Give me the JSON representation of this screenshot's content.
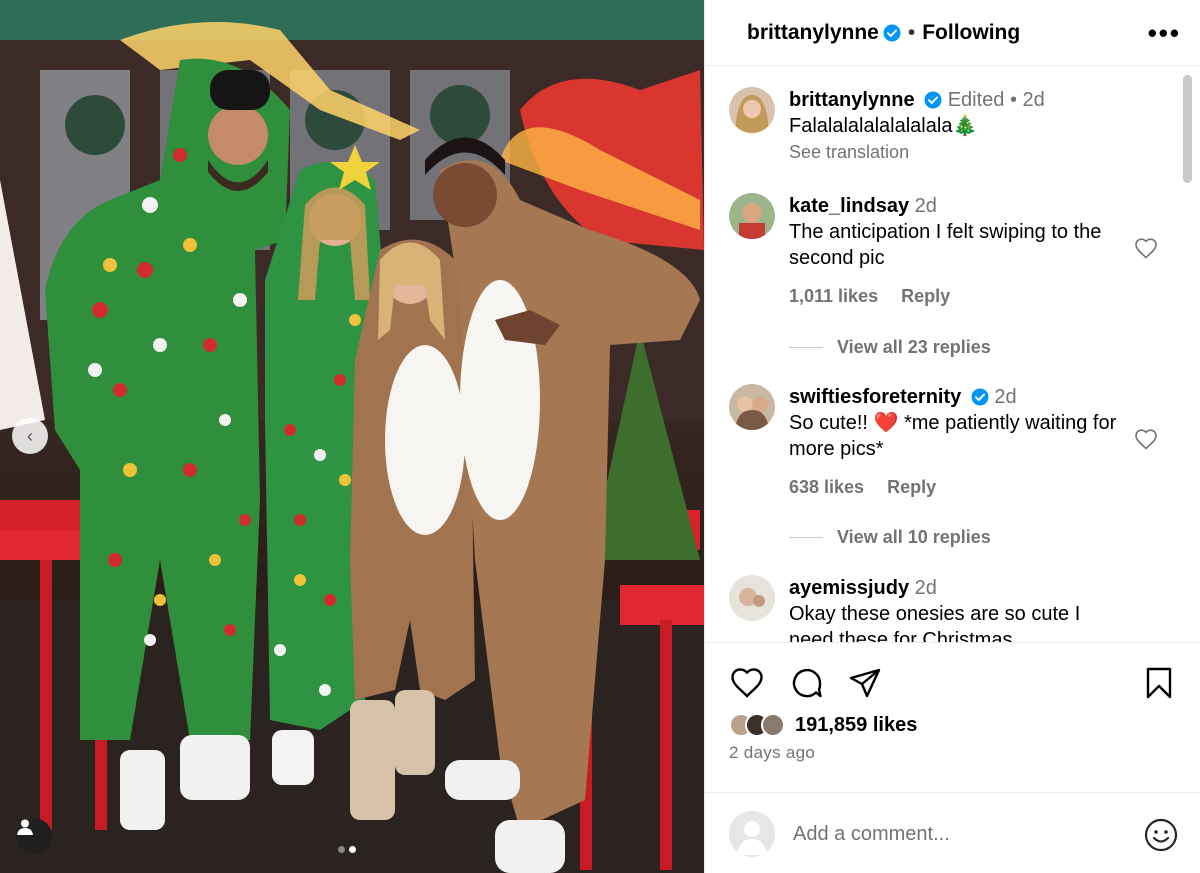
{
  "post": {
    "author": "brittanylynne",
    "following_label": "Following",
    "more_label": "•••",
    "carousel_prev": "‹",
    "page_dots": 2,
    "active_dot": 2
  },
  "caption": {
    "author": "brittanylynne",
    "edited_label": "Edited",
    "time": "2d",
    "text": "Falalalalalalalalala🎄",
    "see_translation": "See translation"
  },
  "comments": [
    {
      "user": "kate_lindsay",
      "verified": false,
      "time": "2d",
      "text": "The anticipation I felt swiping to the second pic",
      "likes": "1,011 likes",
      "reply_label": "Reply",
      "view_replies": "View all 23 replies"
    },
    {
      "user": "swiftiesforeternity",
      "verified": true,
      "time": "2d",
      "text": "So cute!! ❤️ *me patiently waiting for more pics*",
      "likes": "638 likes",
      "reply_label": "Reply",
      "view_replies": "View all 10 replies"
    },
    {
      "user": "ayemissjudy",
      "verified": false,
      "time": "2d",
      "text": "Okay these onesies are so cute I need these for Christmas"
    }
  ],
  "actions": {
    "likes": "191,859 likes",
    "posted": "2 days ago"
  },
  "add_comment": {
    "placeholder": "Add a comment..."
  },
  "colors": {
    "verified_blue": "#0095f6",
    "muted_text": "#737373",
    "heart_red": "#ff3040"
  },
  "icons": [
    "verified-icon",
    "more-icon",
    "heart-icon",
    "comment-icon",
    "share-icon",
    "bookmark-icon",
    "emoji-icon",
    "user-tag-icon",
    "chevron-left-icon"
  ]
}
